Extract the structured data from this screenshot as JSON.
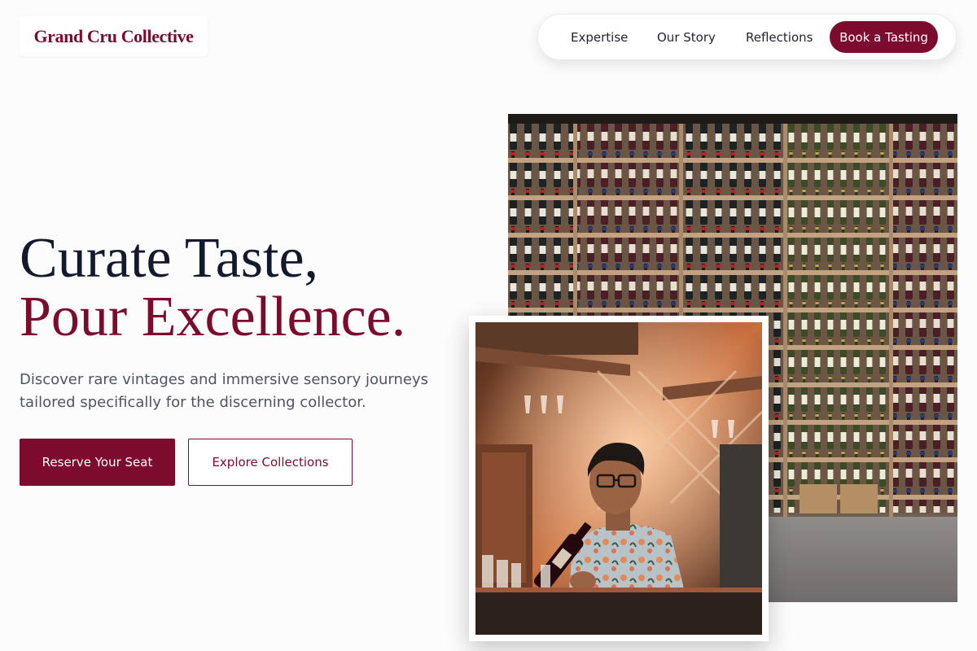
{
  "brand": {
    "name": "Grand Cru Collective"
  },
  "nav": {
    "links": [
      "Expertise",
      "Our Story",
      "Reflections"
    ],
    "cta": "Book a Tasting"
  },
  "hero": {
    "title_line1": "Curate Taste,",
    "title_line2": "Pour Excellence.",
    "subtitle": "Discover rare vintages and immersive sensory journeys tailored specifically for the discerning collector.",
    "primary_button": "Reserve Your Seat",
    "secondary_button": "Explore Collections"
  },
  "images": {
    "shelf": "wine-shelf-photo",
    "bartender": "bartender-with-bottle-photo"
  },
  "colors": {
    "accent": "#7d0b2e",
    "heading": "#141a2e",
    "body_text": "#4d5466",
    "background": "#fcfcfc"
  }
}
